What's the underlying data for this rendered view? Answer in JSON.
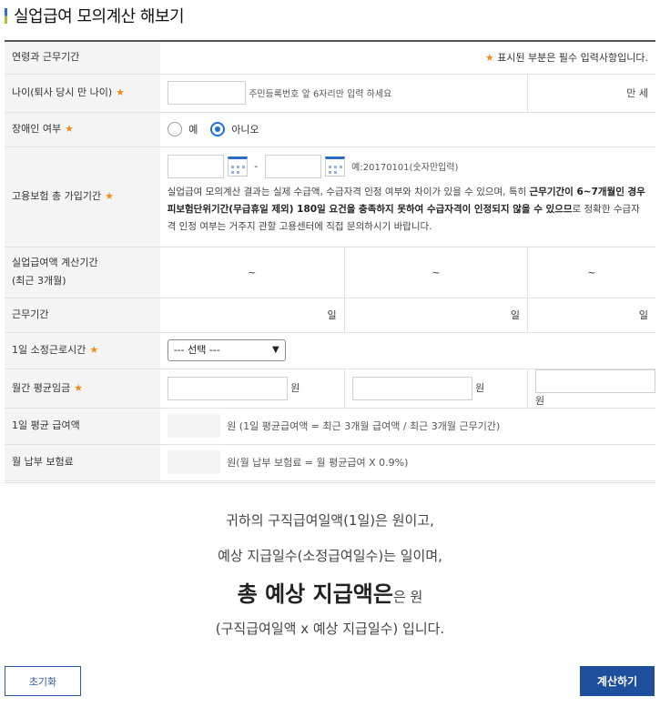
{
  "page": {
    "title": "실업급여 모의계산 해보기",
    "colors": {
      "accent": "#1d4f9c",
      "star": "#f08c1e",
      "radio": "#1f6fdb"
    }
  },
  "form": {
    "header": {
      "label": "연령과 근무기간",
      "required_note": "표시된 부분은 필수 입력사항입니다."
    },
    "age": {
      "label": "나이(퇴사 당시 만 나이)",
      "hint": "주민등록번호 앞 6자리만 입력 하세요",
      "unit": "만 세"
    },
    "disabled": {
      "label": "장애인 여부",
      "yes": "예",
      "no": "아니오",
      "selected": "아니오"
    },
    "insurance": {
      "label": "고용보험 총 가입기간",
      "separator": "-",
      "example": "예:20170101(숫자만입력)",
      "note_pre": "실업급여 모의계산 결과는 실제 수급액, 수급자격 인정 여부와 차이가 있을 수 있으며, 특히 ",
      "note_bold": "근무기간이 6~7개월인 경우 피보험단위기간(무급휴일 제외) 180일 요건을 충족하지 못하여 수급자격이 인정되지 않을 수 있으므",
      "note_post": "로 정확한 수급자격 인정 여부는 거주지 관할 고용센터에 직접 문의하시기 바랍니다."
    },
    "calc_period": {
      "label_line1": "실업급여액 계산기간",
      "label_line2": "(최근 3개월)",
      "tilde": "~"
    },
    "work_days": {
      "label": "근무기간",
      "unit": "일"
    },
    "daily_hours": {
      "label": "1일 소정근로시간",
      "select_value": "--- 선택 ---"
    },
    "monthly_wage": {
      "label": "월간 평균임금",
      "unit": "원"
    },
    "daily_avg": {
      "label": "1일 평균 급여액",
      "text": "원 (1일 평균급여액 = 최근 3개월 급여액 / 최근 3개월 근무기간)"
    },
    "premium": {
      "label": "월 납부 보험료",
      "text": "원(월 납부 보험료 = 월 평균급여 X 0.9%)"
    }
  },
  "result": {
    "line1": "귀하의 구직급여일액(1일)은 원이고,",
    "line2": "예상 지급일수(소정급여일수)는 일이며,",
    "line3_big": "총 예상 지급액은",
    "line3_rest": "은 원",
    "line4": "(구직급여일액 x 예상 지급일수) 입니다."
  },
  "buttons": {
    "reset": "초기화",
    "calculate": "계산하기"
  }
}
